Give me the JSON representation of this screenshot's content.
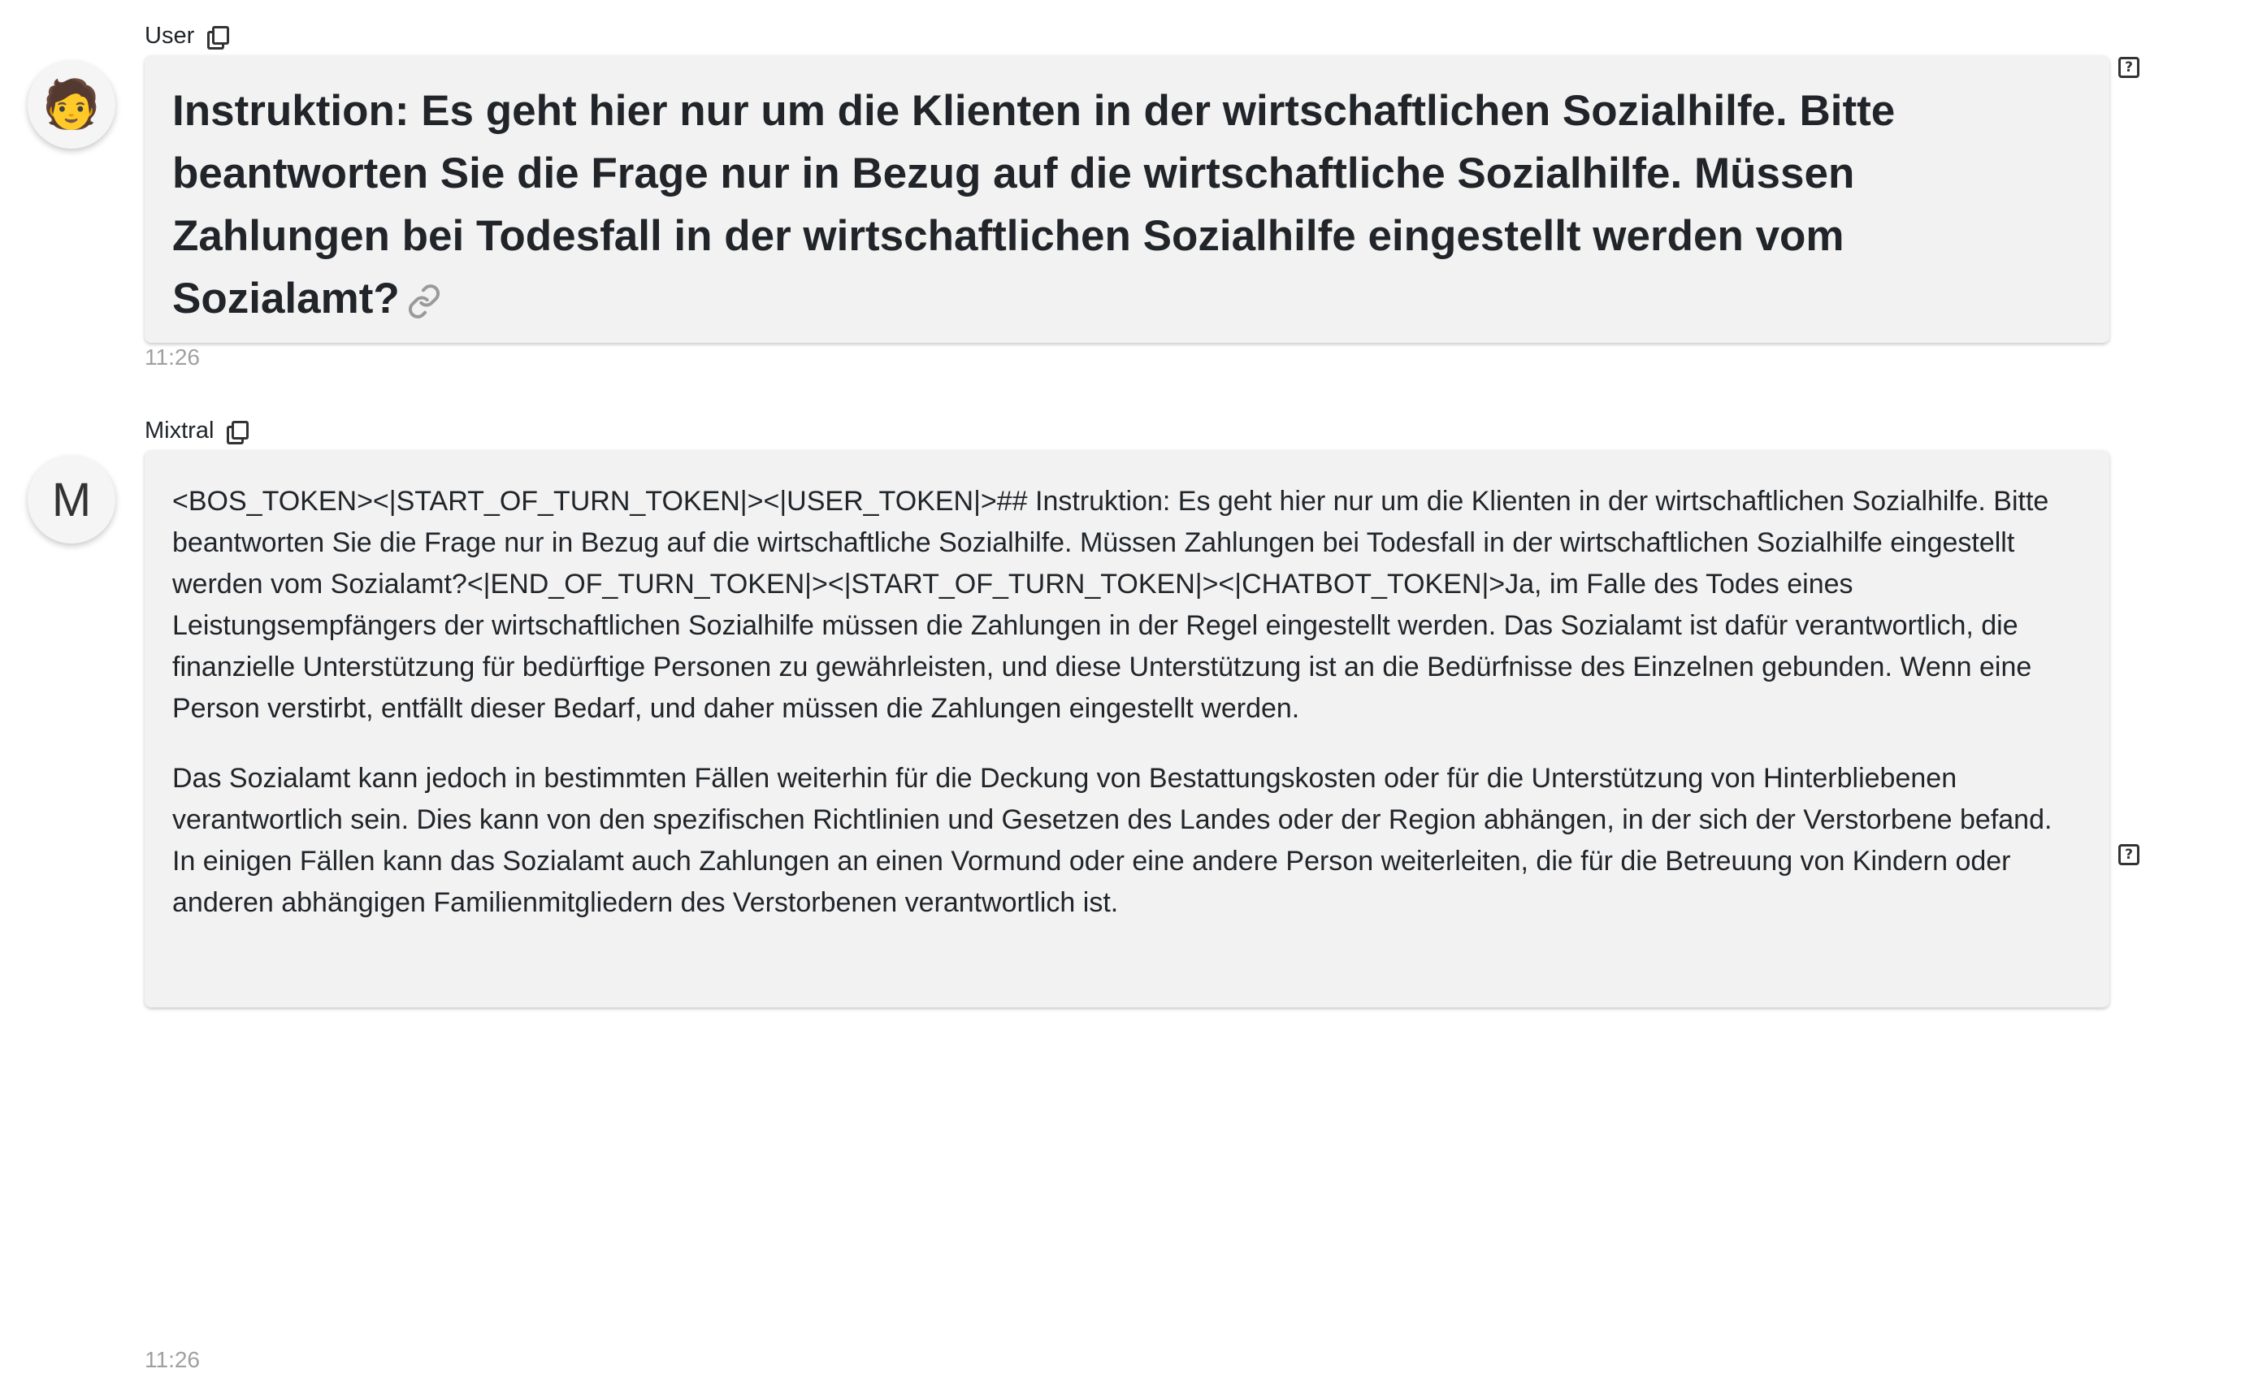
{
  "messages": [
    {
      "sender": "User",
      "avatar": {
        "kind": "emoji",
        "glyph": "🧑",
        "icon": "person-avatar-icon"
      },
      "text": "Instruktion: Es geht hier nur um die Klienten in der wirtschaftlichen Sozialhilfe. Bitte beantworten Sie die Frage nur in Bezug auf die wirtschaftliche Sozialhilfe. Müssen Zahlungen bei Todesfall in der wirtschaftlichen Sozialhilfe eingestellt werden vom Sozialamt?",
      "time": "11:26"
    },
    {
      "sender": "Mixtral",
      "avatar": {
        "kind": "letter",
        "glyph": "M"
      },
      "paragraphs": [
        "<BOS_TOKEN><|START_OF_TURN_TOKEN|><|USER_TOKEN|>## Instruktion: Es geht hier nur um die Klienten in der wirtschaftlichen Sozialhilfe. Bitte beantworten Sie die Frage nur in Bezug auf die wirtschaftliche Sozialhilfe. Müssen Zahlungen bei Todesfall in der wirtschaftlichen Sozialhilfe eingestellt werden vom Sozialamt?<|END_OF_TURN_TOKEN|><|START_OF_TURN_TOKEN|><|CHATBOT_TOKEN|>Ja, im Falle des Todes eines Leistungsempfängers der wirtschaftlichen Sozialhilfe müssen die Zahlungen in der Regel eingestellt werden. Das Sozialamt ist dafür verantwortlich, die finanzielle Unterstützung für bedürftige Personen zu gewährleisten, und diese Unterstützung ist an die Bedürfnisse des Einzelnen gebunden. Wenn eine Person verstirbt, entfällt dieser Bedarf, und daher müssen die Zahlungen eingestellt werden.",
        "Das Sozialamt kann jedoch in bestimmten Fällen weiterhin für die Deckung von Bestattungskosten oder für die Unterstützung von Hinterbliebenen verantwortlich sein. Dies kann von den spezifischen Richtlinien und Gesetzen des Landes oder der Region abhängen, in der sich der Verstorbene befand. In einigen Fällen kann das Sozialamt auch Zahlungen an einen Vormund oder eine andere Person weiterleiten, die für die Betreuung von Kindern oder anderen abhängigen Familienmitgliedern des Verstorbenen verantwortlich ist."
      ],
      "time": "11:26"
    }
  ],
  "icons": {
    "copy": "copy-icon",
    "link": "link-icon",
    "help": "help-icon",
    "help_glyph": "?"
  }
}
